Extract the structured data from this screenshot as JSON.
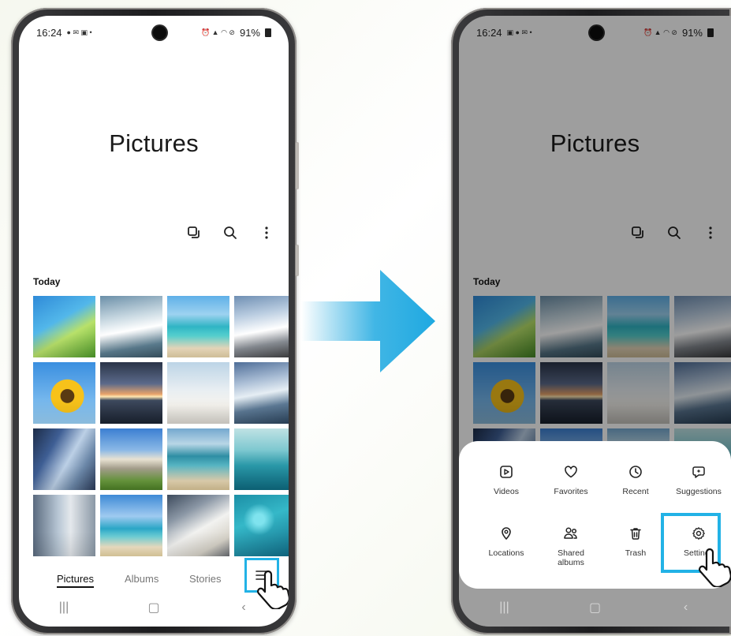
{
  "left_phone": {
    "status": {
      "time": "16:24",
      "battery": "91%"
    },
    "album_title": "Pictures",
    "section_label": "Today",
    "tabs": [
      {
        "label": "Pictures",
        "active": true
      },
      {
        "label": "Albums",
        "active": false
      },
      {
        "label": "Stories",
        "active": false
      }
    ],
    "toolbar_icons": [
      "select-icon",
      "search-icon",
      "more-vert-icon"
    ],
    "menu_icon": "hamburger-menu-icon",
    "system_nav": [
      "recents-icon",
      "home-icon",
      "back-icon"
    ],
    "system_nav_glyphs": [
      "|||",
      "▢",
      "‹"
    ],
    "highlight_color": "#22b2e6"
  },
  "right_phone": {
    "status": {
      "time": "16:24",
      "battery": "91%"
    },
    "album_title": "Pictures",
    "section_label": "Today",
    "system_nav_glyphs": [
      "|||",
      "▢",
      "‹"
    ],
    "menu_sheet": {
      "items": [
        {
          "label": "Videos",
          "icon": "video-icon"
        },
        {
          "label": "Favorites",
          "icon": "heart-icon"
        },
        {
          "label": "Recent",
          "icon": "clock-icon"
        },
        {
          "label": "Suggestions",
          "icon": "suggestions-icon"
        },
        {
          "label": "Locations",
          "icon": "location-pin-icon"
        },
        {
          "label": "Shared albums",
          "icon": "people-icon"
        },
        {
          "label": "Trash",
          "icon": "trash-icon"
        },
        {
          "label": "Settings",
          "icon": "gear-icon"
        }
      ]
    },
    "highlight_color": "#22b2e6"
  },
  "transition_arrow_color": "#1fa9e1"
}
